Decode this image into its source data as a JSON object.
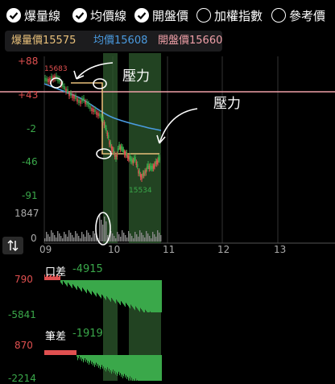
{
  "options": [
    {
      "label": "爆量線",
      "checked": true
    },
    {
      "label": "均價線",
      "checked": true
    },
    {
      "label": "開盤價",
      "checked": true
    },
    {
      "label": "加權指數",
      "checked": false
    },
    {
      "label": "參考價",
      "checked": false
    }
  ],
  "legend": {
    "burst": "爆量價15575",
    "avg": "均價15608",
    "open": "開盤價15660"
  },
  "colors": {
    "up": "#e05050",
    "down": "#3aa84a",
    "burst": "#e8c07a",
    "avg": "#4a9be0",
    "open": "#f0a0a8",
    "pressure": "#e8d050",
    "band": "#2e5a2e"
  },
  "price_axis": {
    "ticks": [
      "+88",
      "+43",
      "-2",
      "-46",
      "-91"
    ]
  },
  "price_labels": {
    "high": "15683",
    "low": "15534"
  },
  "volume_axis": {
    "top": "1847",
    "bottom": "0"
  },
  "time_axis": [
    "09",
    "10",
    "11",
    "12",
    "13"
  ],
  "annotations": {
    "pressure1": "壓力",
    "pressure2": "壓力"
  },
  "spread_panel": {
    "title": "口差",
    "value": "-4915",
    "top": "790",
    "bottom": "-5841"
  },
  "count_panel": {
    "title": "筆差",
    "value": "-1919",
    "top": "870",
    "bottom": "-2214"
  },
  "toggle_icon": "swap-vertical-icon"
}
